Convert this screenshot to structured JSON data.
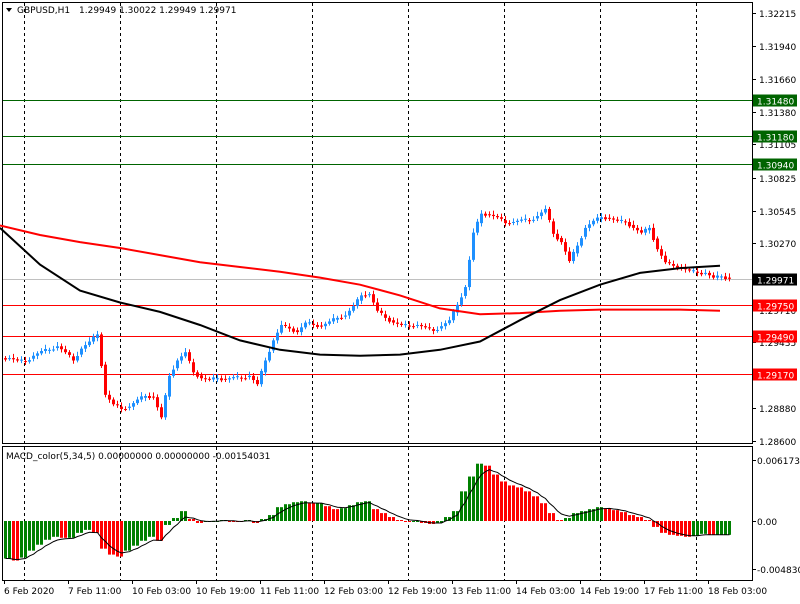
{
  "header": {
    "symbol": "GBPUSD,H1",
    "ohlc": "1.29949 1.30022 1.29949 1.29971"
  },
  "indicator_label": "MACD_color(5,34,5) 0.00000000 0.00000000 -0.00154031",
  "colors": {
    "bull": "#1e90ff",
    "bear": "#ff0000",
    "resistance": "#006400",
    "support": "#ff0000",
    "ma_fast": "#000000",
    "ma_slow": "#ff0000",
    "macd_up": "#008000",
    "macd_down": "#ff0000"
  },
  "chart_data": [
    {
      "type": "candlestick",
      "title": "GBPUSD,H1",
      "ylim": [
        1.286,
        1.32215
      ],
      "bars_per_sample": 2,
      "price_ticks": [
        "1.32215",
        "1.31940",
        "1.31660",
        "1.31380",
        "1.31105",
        "1.30825",
        "1.30545",
        "1.30270",
        "1.29710",
        "1.29435",
        "1.28880",
        "1.28600"
      ],
      "time_labels": [
        "6 Feb 2020",
        "7 Feb 11:00",
        "10 Feb 03:00",
        "10 Feb 19:00",
        "11 Feb 11:00",
        "12 Feb 03:00",
        "12 Feb 19:00",
        "13 Feb 11:00",
        "14 Feb 03:00",
        "14 Feb 19:00",
        "17 Feb 11:00",
        "18 Feb 03:00"
      ],
      "close": [
        1.293,
        1.2928,
        1.2927,
        1.2932,
        1.2936,
        1.2937,
        1.294,
        1.2935,
        1.2928,
        1.2938,
        1.2944,
        1.295,
        1.2899,
        1.2891,
        1.2887,
        1.2889,
        1.2895,
        1.2898,
        1.2897,
        1.288,
        1.2915,
        1.2928,
        1.2935,
        1.2918,
        1.2913,
        1.2912,
        1.2913,
        1.2912,
        1.2914,
        1.2913,
        1.2915,
        1.2908,
        1.2928,
        1.2945,
        1.2958,
        1.2955,
        1.2952,
        1.296,
        1.2958,
        1.2957,
        1.2961,
        1.2964,
        1.2966,
        1.2974,
        1.2983,
        1.2984,
        1.297,
        1.2964,
        1.296,
        1.2958,
        1.2957,
        1.2958,
        1.2956,
        1.2953,
        1.2957,
        1.2962,
        1.2975,
        1.299,
        1.3036,
        1.3052,
        1.3051,
        1.3049,
        1.3044,
        1.3045,
        1.3047,
        1.3046,
        1.305,
        1.3056,
        1.3035,
        1.3028,
        1.3012,
        1.3025,
        1.304,
        1.3046,
        1.3049,
        1.3048,
        1.3046,
        1.3045,
        1.304,
        1.3036,
        1.304,
        1.3022,
        1.3011,
        1.3008,
        1.3006,
        1.3004,
        1.3002,
        1.3002,
        1.2998,
        1.2999,
        1.2997
      ],
      "ma_fast": [
        1.304,
        1.3009,
        1.2987,
        1.2977,
        1.2969,
        1.2958,
        1.2945,
        1.2937,
        1.2933,
        1.2932,
        1.2933,
        1.2937,
        1.2944,
        1.2962,
        1.2979,
        1.2992,
        1.3002,
        1.3006,
        1.3008
      ],
      "ma_slow": [
        1.3042,
        1.3034,
        1.3028,
        1.3023,
        1.3017,
        1.3011,
        1.3007,
        1.3003,
        1.2998,
        1.2992,
        1.2983,
        1.2972,
        1.2967,
        1.2968,
        1.297,
        1.2971,
        1.2971,
        1.2971,
        1.297
      ],
      "ma_bars_per_point": 10,
      "current_price": "1.29971",
      "resistance_levels": [
        "1.31480",
        "1.31180",
        "1.30940"
      ],
      "support_levels": [
        "1.29750",
        "1.29490",
        "1.29170"
      ]
    },
    {
      "type": "bar",
      "title": "MACD_color(5,34,5)",
      "ylim": [
        -0.00483,
        0.0061732
      ],
      "ticks": [
        "0.0061732",
        "0.00",
        "-0.004830"
      ],
      "histogram": [
        -0.0038,
        -0.004,
        -0.0037,
        -0.003,
        -0.0024,
        -0.0019,
        -0.0016,
        -0.0017,
        -0.0017,
        -0.0012,
        -0.0009,
        -0.0012,
        -0.0028,
        -0.0034,
        -0.0036,
        -0.003,
        -0.0025,
        -0.002,
        -0.0016,
        -0.002,
        -0.0004,
        0.0003,
        0.001,
        0.0002,
        -0.0002,
        -0.0001,
        0.0,
        0.0001,
        0.0,
        -0.0001,
        0.0001,
        -0.0002,
        0.0002,
        0.0006,
        0.0014,
        0.0017,
        0.0019,
        0.002,
        0.0018,
        0.0018,
        0.0015,
        0.0012,
        0.0013,
        0.0016,
        0.0019,
        0.002,
        0.0012,
        0.0008,
        0.0004,
        0.0001,
        -0.0001,
        0.0,
        -0.0002,
        -0.0003,
        -0.0002,
        0.0004,
        0.001,
        0.003,
        0.0045,
        0.0058,
        0.0056,
        0.0047,
        0.004,
        0.0036,
        0.0034,
        0.003,
        0.0025,
        0.0018,
        0.0008,
        0.0001,
        0.0003,
        0.0008,
        0.001,
        0.0012,
        0.0014,
        0.0013,
        0.0011,
        0.0009,
        0.0006,
        0.0004,
        0.0001,
        -0.0006,
        -0.0012,
        -0.0014,
        -0.0015,
        -0.0016,
        -0.0015,
        -0.0013,
        -0.0014,
        -0.0014,
        -0.0014
      ]
    }
  ]
}
